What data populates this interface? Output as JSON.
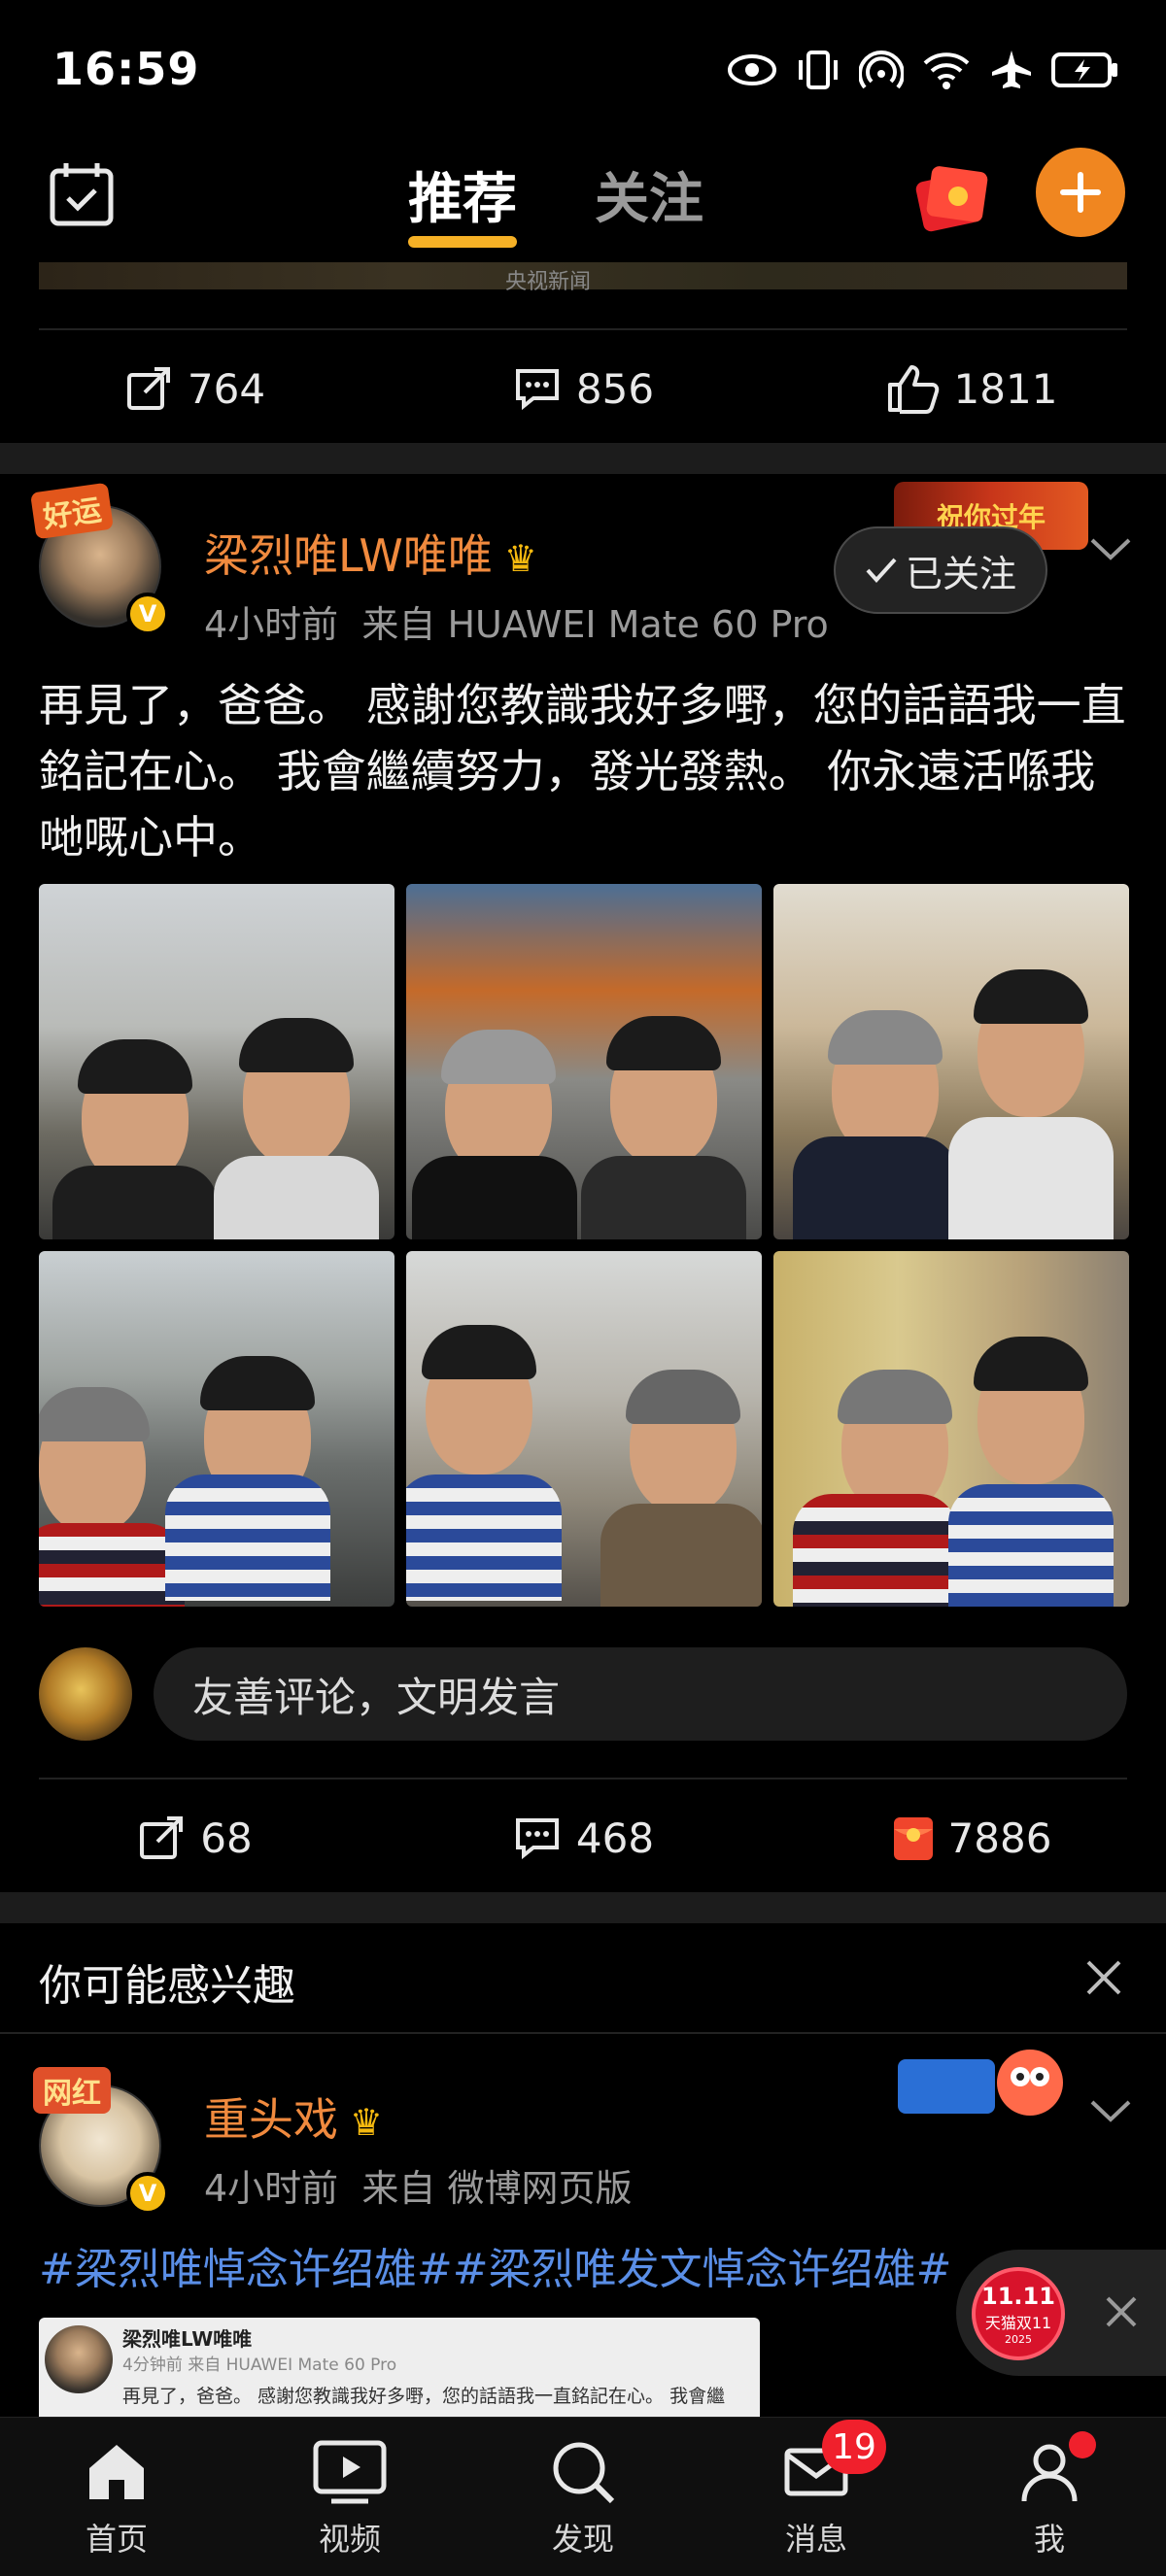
{
  "status_bar": {
    "time": "16:59"
  },
  "top_nav": {
    "tabs": [
      {
        "label": "推荐",
        "active": true
      },
      {
        "label": "关注",
        "active": false
      }
    ],
    "accent_color": "#f6b126"
  },
  "prev_post": {
    "source_tag": "央视新闻",
    "actions": {
      "repost": "764",
      "comment": "856",
      "like": "1811"
    }
  },
  "post": {
    "avatar_badge": "好运",
    "username": "梁烈唯LW唯唯",
    "time": "4小时前",
    "source": "来自 HUAWEI Mate 60 Pro",
    "follow_label": "已关注",
    "banner_text": "祝你过年",
    "text": "再見了，爸爸。 感謝您教識我好多嘢，您的話語我一直銘記在心。 我會繼續努力，發光發熱。 你永遠活喺我哋嘅心中。",
    "photo_count": 6,
    "comment_placeholder": "友善评论，文明发言",
    "actions": {
      "repost": "68",
      "comment": "468",
      "like": "7886"
    }
  },
  "interest": {
    "title": "你可能感兴趣",
    "post": {
      "avatar_badge": "网红",
      "username": "重头戏",
      "time": "4小时前",
      "source": "来自 微博网页版",
      "hashtags": "#梁烈唯悼念许绍雄##梁烈唯发文悼念许绍雄#",
      "repost_card": {
        "name": "梁烈唯LW唯唯",
        "meta": "4分钟前 来自 HUAWEI Mate 60 Pro",
        "text": "再見了，爸爸。 感謝您教識我好多嘢，您的話語我一直銘記在心。 我會繼"
      }
    }
  },
  "ad": {
    "line1": "11.11",
    "line2": "天猫双11",
    "line3": "2025"
  },
  "bottom_nav": [
    {
      "label": "首页",
      "icon": "home-icon"
    },
    {
      "label": "视频",
      "icon": "video-icon"
    },
    {
      "label": "发现",
      "icon": "search-icon"
    },
    {
      "label": "消息",
      "icon": "message-icon",
      "badge": "19"
    },
    {
      "label": "我",
      "icon": "profile-icon"
    }
  ],
  "colors": {
    "username": "#f08a3e",
    "hashtag": "#5a8ee6",
    "plus_button": "#f08620",
    "verified": "#f5b90f",
    "badge_red": "#f0202c"
  }
}
